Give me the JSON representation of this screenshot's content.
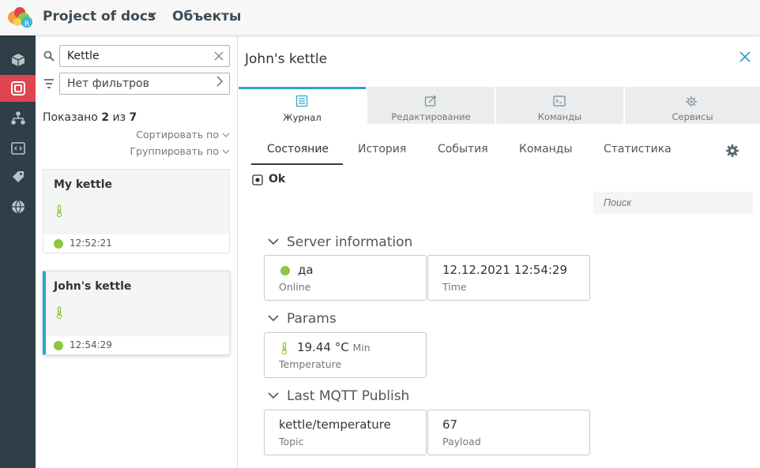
{
  "header": {
    "project": "Project of docs",
    "breadcrumb": "Объекты"
  },
  "rail": {
    "items": [
      {
        "icon": "cube-icon"
      },
      {
        "icon": "objects-icon",
        "active": true
      },
      {
        "icon": "hierarchy-icon"
      },
      {
        "icon": "code-icon"
      },
      {
        "icon": "tag-icon"
      },
      {
        "icon": "globe-icon"
      }
    ],
    "active_color": "#e0454f",
    "bg_color": "#2f3e47"
  },
  "list": {
    "search_value": "Kettle",
    "filter_label": "Нет фильтров",
    "shown_prefix": "Показано",
    "shown_count": "2",
    "shown_mid": "из",
    "shown_total": "7",
    "sort_label": "Сортировать по",
    "group_label": "Группировать по",
    "items": [
      {
        "title": "My kettle",
        "status": "online",
        "time": "12:52:21"
      },
      {
        "title": "John's kettle",
        "status": "online",
        "time": "12:54:29",
        "selected": true
      }
    ]
  },
  "detail": {
    "title": "John's kettle",
    "tabs": [
      {
        "label": "Журнал",
        "icon": "journal-icon",
        "active": true
      },
      {
        "label": "Редактирование",
        "icon": "edit-icon"
      },
      {
        "label": "Команды",
        "icon": "terminal-icon"
      },
      {
        "label": "Сервисы",
        "icon": "services-icon"
      }
    ],
    "subtabs": [
      {
        "label": "Состояние",
        "active": true
      },
      {
        "label": "История"
      },
      {
        "label": "События"
      },
      {
        "label": "Команды"
      },
      {
        "label": "Статистика"
      }
    ],
    "status_text": "Ok",
    "search_placeholder": "Поиск",
    "sections": [
      {
        "title": "Server information",
        "tiles": [
          {
            "value": "да",
            "label": "Online",
            "dot": true
          },
          {
            "value": "12.12.2021 12:54:29",
            "label": "Time"
          }
        ]
      },
      {
        "title": "Params",
        "tiles": [
          {
            "value": "19.44 °C",
            "extra": "Min",
            "label": "Temperature",
            "thermo": true
          }
        ]
      },
      {
        "title": "Last MQTT Publish",
        "tiles": [
          {
            "value": "kettle/temperature",
            "label": "Topic"
          },
          {
            "value": "67",
            "label": "Payload"
          }
        ]
      }
    ]
  },
  "colors": {
    "accent": "#2fa4c9",
    "online": "#8dc63f",
    "rail": "#2f3e47",
    "rail_active": "#e0454f"
  }
}
